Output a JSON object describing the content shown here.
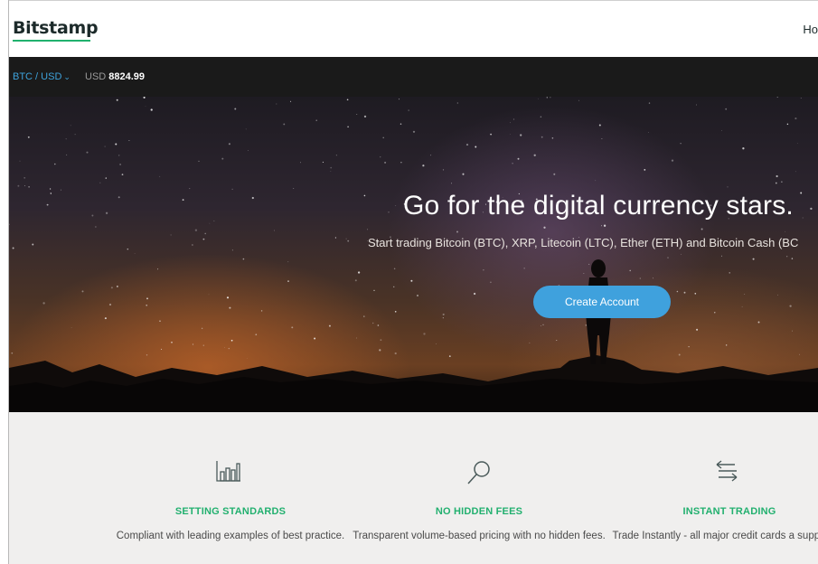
{
  "header": {
    "logo": "Bitstamp",
    "nav_home": "Ho"
  },
  "ticker": {
    "pair": "BTC / USD",
    "price_currency": "USD",
    "price_value": "8824.99"
  },
  "hero": {
    "title": "Go for the digital currency stars.",
    "subtitle": "Start trading Bitcoin (BTC), XRP, Litecoin (LTC), Ether (ETH) and Bitcoin Cash (BC",
    "cta_label": "Create Account"
  },
  "features": [
    {
      "icon": "bar-chart-icon",
      "title": "SETTING STANDARDS",
      "desc": "Compliant with leading examples of best practice."
    },
    {
      "icon": "magnifier-icon",
      "title": "NO HIDDEN FEES",
      "desc": "Transparent volume-based pricing with no hidden fees."
    },
    {
      "icon": "exchange-arrows-icon",
      "title": "INSTANT TRADING",
      "desc": "Trade Instantly - all major credit cards a supported."
    }
  ],
  "colors": {
    "accent_green": "#22b06f",
    "accent_blue": "#3fa1dd",
    "ticker_bg": "#1a1a1a"
  }
}
